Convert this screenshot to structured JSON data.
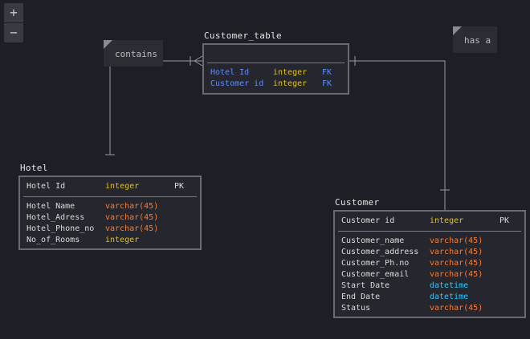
{
  "zoom": {
    "in_label": "+",
    "out_label": "−"
  },
  "notes": {
    "contains": "contains",
    "has_a": "has a"
  },
  "customer_table": {
    "title": "Customer_table",
    "rows": [
      {
        "name": "Hotel Id",
        "type": "integer",
        "key": "FK"
      },
      {
        "name": "Customer id",
        "type": "integer",
        "key": "FK"
      }
    ]
  },
  "hotel": {
    "title": "Hotel",
    "pk": {
      "name": "Hotel Id",
      "type": "integer",
      "key": "PK"
    },
    "rows": [
      {
        "name": "Hotel Name",
        "type": "varchar(45)"
      },
      {
        "name": "Hotel_Adress",
        "type": "varchar(45)"
      },
      {
        "name": "Hotel_Phone_no",
        "type": "varchar(45)"
      },
      {
        "name": "No_of_Rooms",
        "type": "integer"
      }
    ]
  },
  "customer": {
    "title": "Customer",
    "pk": {
      "name": "Customer id",
      "type": "integer",
      "key": "PK"
    },
    "rows": [
      {
        "name": "Customer_name",
        "type": "varchar(45)"
      },
      {
        "name": "Customer_address",
        "type": "varchar(45)"
      },
      {
        "name": "Customer_Ph.no",
        "type": "varchar(45)"
      },
      {
        "name": "Customer_email",
        "type": "varchar(45)"
      },
      {
        "name": "Start Date",
        "type": "datetime"
      },
      {
        "name": "End Date",
        "type": "datetime"
      },
      {
        "name": "Status",
        "type": "varchar(45)"
      }
    ]
  },
  "colors": {
    "background": "#1e1f26",
    "integer": "#e0c020",
    "varchar": "#ff7a2a",
    "datetime": "#2ac8ff",
    "foreign_key": "#5b8cff"
  }
}
